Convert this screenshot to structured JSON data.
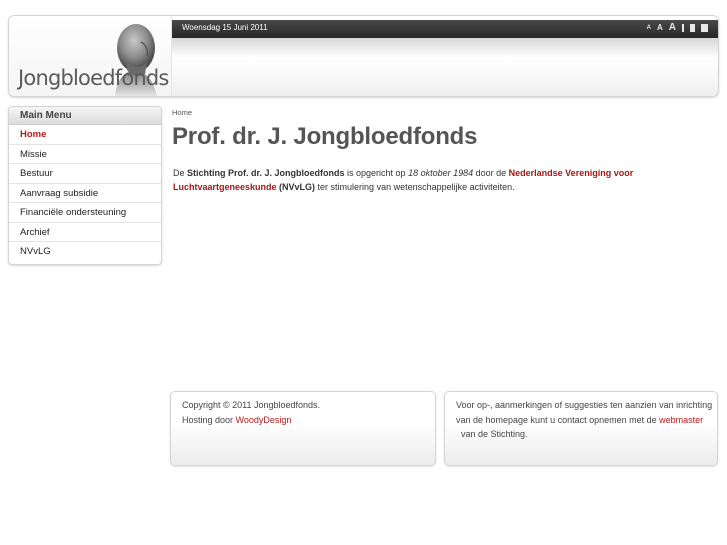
{
  "header": {
    "logo_text": "Jongbloedfonds",
    "date": "Woensdag 15 Juni 2011",
    "font_tools": [
      "A",
      "A",
      "A"
    ]
  },
  "menu": {
    "title": "Main Menu",
    "items": [
      {
        "label": "Home",
        "active": true
      },
      {
        "label": "Missie"
      },
      {
        "label": "Bestuur"
      },
      {
        "label": "Aanvraag subsidie"
      },
      {
        "label": "Financiële ondersteuning"
      },
      {
        "label": "Archief"
      },
      {
        "label": "NVvLG"
      }
    ]
  },
  "main": {
    "breadcrumb": "Home",
    "title": "Prof. dr. J. Jongbloedfonds",
    "intro": {
      "p1": "De ",
      "b1": "Stichting Prof. dr. J. Jongbloedfonds",
      "p2": " is opgericht op ",
      "i1": "18 oktober 1984",
      "p3": " door de ",
      "org1": "Nederlandse Vereniging voor Luchtvaartgeneeskunde",
      "p4": " ",
      "b2": "(NVvLG)",
      "p5": " ter stimulering van wetenschappelijke activiteiten."
    }
  },
  "footer": {
    "left": {
      "line1": "Copyright © 2011 Jongbloedfonds.",
      "hosting_prefix": "Hosting door ",
      "hosting_link": "WoodyDesign"
    },
    "right": {
      "text": "Voor op-, aanmerkingen of suggesties ten aanzien van inrichting van de homepage kunt u contact opnemen met de ",
      "link": "webmaster",
      "suffix": "  van de Stichting."
    }
  },
  "colors": {
    "accent": "#b31b1b",
    "title": "#555555",
    "topbar": "#2e2e2e"
  }
}
